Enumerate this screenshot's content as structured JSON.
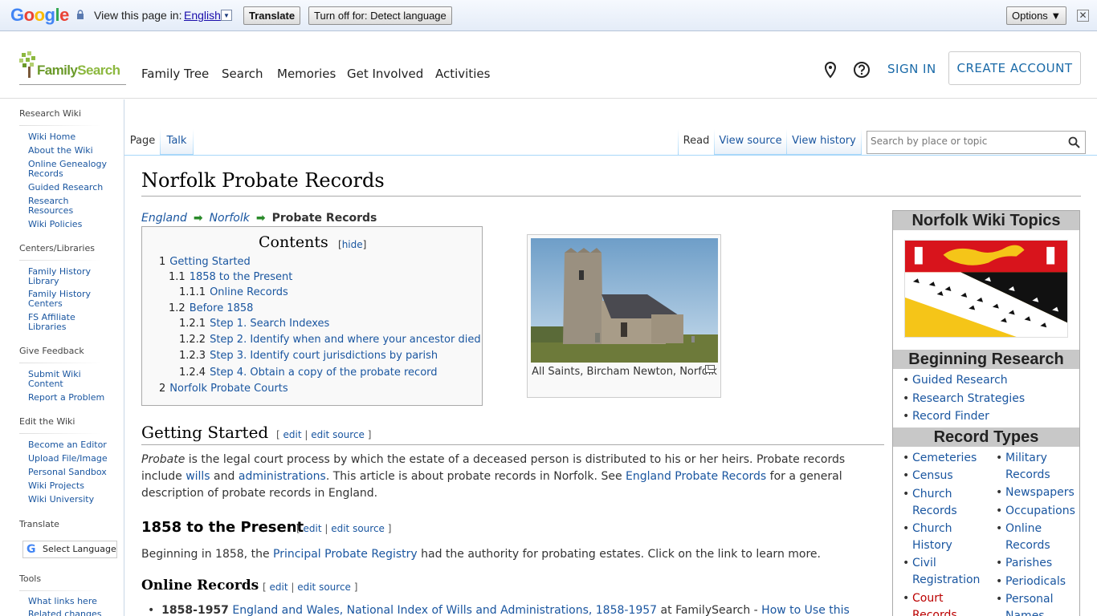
{
  "translate_bar": {
    "google_logo": "Google",
    "view_text": "View this page in:",
    "language": "English",
    "translate_label": "Translate",
    "turn_off_label": "Turn off for: Detect language",
    "options_label": "Options ▼",
    "close_label": "✕"
  },
  "header": {
    "logo_family": "Family",
    "logo_search": "Search",
    "nav": [
      "Family Tree",
      "Search",
      "Memories",
      "Get Involved",
      "Activities"
    ],
    "sign_in": "SIGN IN",
    "create_account": "CREATE ACCOUNT",
    "icons": [
      "location-pin-icon",
      "help-icon"
    ]
  },
  "sidebar": {
    "sections": [
      {
        "heading": "Research Wiki",
        "items": [
          "Wiki Home",
          "About the Wiki",
          "Online Genealogy Records",
          "Guided Research",
          "Research Resources",
          "Wiki Policies"
        ]
      },
      {
        "heading": "Centers/Libraries",
        "items": [
          "Family History Library",
          "Family History Centers",
          "FS Affiliate Libraries"
        ]
      },
      {
        "heading": "Give Feedback",
        "items": [
          "Submit Wiki Content",
          "Report a Problem"
        ]
      },
      {
        "heading": "Edit the Wiki",
        "items": [
          "Become an Editor",
          "Upload File/Image",
          "Personal Sandbox",
          "Wiki Projects",
          "Wiki University"
        ]
      },
      {
        "heading": "Translate",
        "items": []
      },
      {
        "heading": "Tools",
        "items": [
          "What links here",
          "Related changes"
        ]
      }
    ],
    "select_language": "Select Language"
  },
  "tabs": {
    "left": [
      "Page",
      "Talk"
    ],
    "right": [
      "Read",
      "View source",
      "View history"
    ],
    "search_placeholder": "Search by place or topic"
  },
  "page": {
    "title": "Norfolk Probate Records",
    "breadcrumb": [
      "England",
      "Norfolk",
      "Probate Records"
    ],
    "toc": {
      "heading": "Contents",
      "hide_label": "hide",
      "items": [
        {
          "num": "1",
          "text": "Getting Started",
          "level": 1
        },
        {
          "num": "1.1",
          "text": "1858 to the Present",
          "level": 2
        },
        {
          "num": "1.1.1",
          "text": "Online Records",
          "level": 3
        },
        {
          "num": "1.2",
          "text": "Before 1858",
          "level": 2
        },
        {
          "num": "1.2.1",
          "text": "Step 1. Search Indexes",
          "level": 3
        },
        {
          "num": "1.2.2",
          "text": "Step 2. Identify when and where your ancestor died",
          "level": 3
        },
        {
          "num": "1.2.3",
          "text": "Step 3. Identify court jurisdictions by parish",
          "level": 3
        },
        {
          "num": "1.2.4",
          "text": "Step 4. Obtain a copy of the probate record",
          "level": 3
        },
        {
          "num": "2",
          "text": "Norfolk Probate Courts",
          "level": 1
        }
      ]
    },
    "image_caption": "All Saints, Bircham Newton, Norfolk",
    "edit": "edit",
    "edit_source": "edit source",
    "sections": {
      "getting_started": "Getting Started",
      "gs_para": {
        "probate": "Probate",
        "t1": " is the legal court process by which the estate of a deceased person is distributed to his or her heirs. Probate records include ",
        "wills": "wills",
        "and": " and ",
        "admins": "administrations",
        "t2": ". This article is about probate records in Norfolk. See ",
        "epr": "England Probate Records",
        "t3": " for a general description of probate records in England."
      },
      "present": "1858 to the Present",
      "present_para": {
        "t1": "Beginning in 1858, the ",
        "ppr": "Principal Probate Registry",
        "t2": " had the authority for probating estates. Click on the link to learn more."
      },
      "online": "Online Records",
      "online_item": {
        "years": "1858-1957",
        "link": "England and Wales, National Index of Wills and Administrations, 1858-1957",
        "t1": " at FamilySearch - ",
        "howto": "How to Use this"
      }
    }
  },
  "infobox": {
    "title": "Norfolk Wiki Topics",
    "beginning": "Beginning Research",
    "beginning_items": [
      "Guided Research",
      "Research Strategies",
      "Record Finder"
    ],
    "record_types": "Record Types",
    "col1": [
      "Cemeteries",
      "Census",
      "Church Records",
      "Church History",
      "Civil Registration",
      "Court Records"
    ],
    "col2": [
      "Military Records",
      "Newspapers",
      "Occupations",
      "Online Records",
      "Parishes",
      "Periodicals",
      "Personal Names"
    ]
  }
}
